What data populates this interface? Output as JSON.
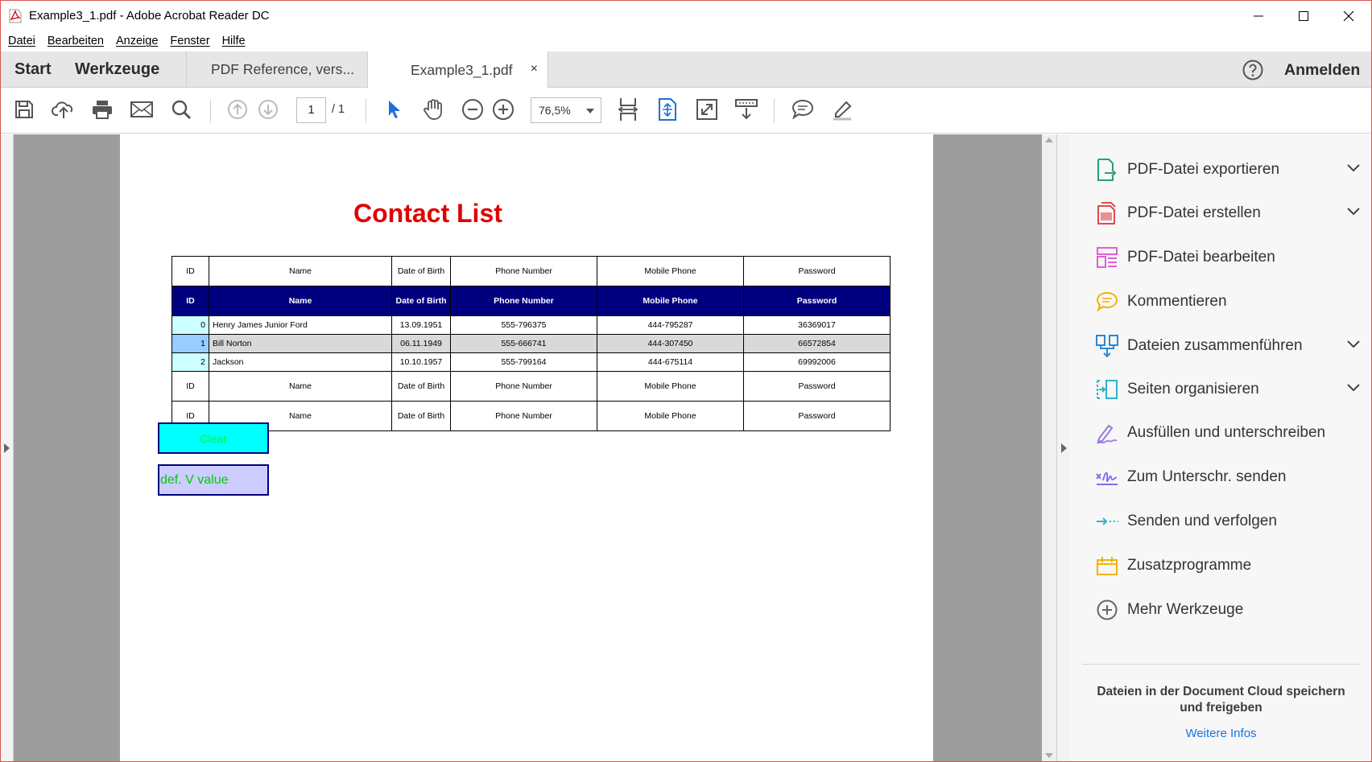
{
  "window": {
    "title": "Example3_1.pdf - Adobe Acrobat Reader DC"
  },
  "menu": [
    "Datei",
    "Bearbeiten",
    "Anzeige",
    "Fenster",
    "Hilfe"
  ],
  "tabs": {
    "start": "Start",
    "tools": "Werkzeuge",
    "doc1": "PDF Reference, vers...",
    "doc2": "Example3_1.pdf",
    "close": "×",
    "signin": "Anmelden"
  },
  "toolbar": {
    "page_current": "1",
    "page_total": "/ 1",
    "zoom": "76,5%"
  },
  "document": {
    "title": "Contact List",
    "header": {
      "id": "ID",
      "name": "Name",
      "dob": "Date of Birth",
      "phone": "Phone Number",
      "mobile": "Mobile Phone",
      "password": "Password"
    },
    "rows": [
      {
        "id": "0",
        "name": "Henry James Junior Ford",
        "dob": "13.09.1951",
        "phone": "555-796375",
        "mobile": "444-795287",
        "password": "36369017"
      },
      {
        "id": "1",
        "name": "Bill Norton",
        "dob": "06.11.1949",
        "phone": "555-666741",
        "mobile": "444-307450",
        "password": "66572854"
      },
      {
        "id": "2",
        "name": "Jackson",
        "dob": "10.10.1957",
        "phone": "555-799164",
        "mobile": "444-675114",
        "password": "69992006"
      }
    ],
    "clear_button": "Clear",
    "field_value": "def. V value"
  },
  "right_panel": {
    "tools": [
      {
        "label": "PDF-Datei exportieren",
        "icon": "export-pdf-icon",
        "expandable": true
      },
      {
        "label": "PDF-Datei erstellen",
        "icon": "create-pdf-icon",
        "expandable": true
      },
      {
        "label": "PDF-Datei bearbeiten",
        "icon": "edit-pdf-icon",
        "expandable": false
      },
      {
        "label": "Kommentieren",
        "icon": "comment-icon",
        "expandable": false
      },
      {
        "label": "Dateien zusammenführen",
        "icon": "combine-files-icon",
        "expandable": true
      },
      {
        "label": "Seiten organisieren",
        "icon": "organize-pages-icon",
        "expandable": true
      },
      {
        "label": "Ausfüllen und unterschreiben",
        "icon": "fill-sign-icon",
        "expandable": false
      },
      {
        "label": "Zum Unterschr. senden",
        "icon": "send-for-signature-icon",
        "expandable": false
      },
      {
        "label": "Senden und verfolgen",
        "icon": "send-track-icon",
        "expandable": false
      },
      {
        "label": "Zusatzprogramme",
        "icon": "addons-icon",
        "expandable": false
      },
      {
        "label": "Mehr Werkzeuge",
        "icon": "more-tools-icon",
        "expandable": false
      }
    ],
    "promo_line1": "Dateien in der Document Cloud speichern",
    "promo_line2": "und freigeben",
    "promo_link": "Weitere Infos"
  },
  "colors": {
    "doc_title": "#e00000",
    "table_header_bg": "#00007f",
    "clear_bg": "#00ffff",
    "field_bg": "#ccccff",
    "link": "#1473e6"
  }
}
